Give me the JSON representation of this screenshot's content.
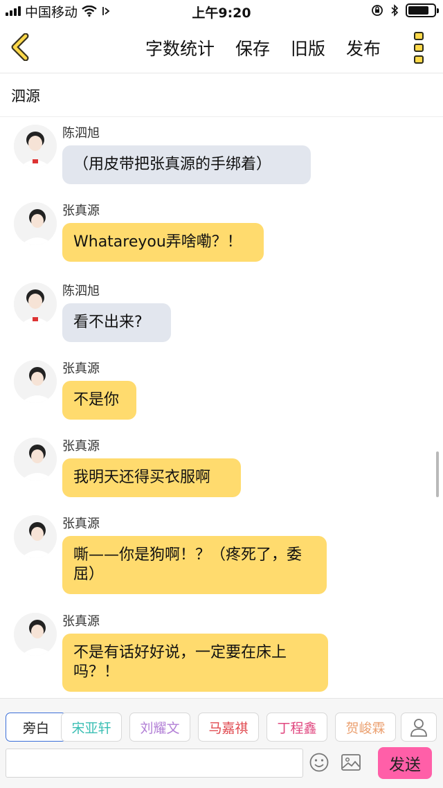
{
  "status_bar": {
    "carrier": "中国移动",
    "time": "上午9:20"
  },
  "toolbar": {
    "word_count_label": "字数统计",
    "save_label": "保存",
    "old_version_label": "旧版",
    "publish_label": "发布"
  },
  "title": "泗源",
  "messages": [
    {
      "sender": "陈泗旭",
      "text": "（用皮带把张真源的手绑着）",
      "style": "gray"
    },
    {
      "sender": "张真源",
      "text": "Whatareyou弄啥嘞？！",
      "style": "yellow"
    },
    {
      "sender": "陈泗旭",
      "text": "看不出来?",
      "style": "gray"
    },
    {
      "sender": "张真源",
      "text": "不是你",
      "style": "yellow"
    },
    {
      "sender": "张真源",
      "text": "我明天还得买衣服啊",
      "style": "yellow"
    },
    {
      "sender": "张真源",
      "text": "嘶——你是狗啊！？（疼死了，委屈）",
      "style": "yellow"
    },
    {
      "sender": "张真源",
      "text": "不是有话好好说，一定要在床上吗？！",
      "style": "yellow"
    }
  ],
  "roles": [
    {
      "label": "旁白",
      "color": "#222222"
    },
    {
      "label": "宋亚轩",
      "color": "#3bbfb4"
    },
    {
      "label": "刘耀文",
      "color": "#b27fd6"
    },
    {
      "label": "马嘉祺",
      "color": "#e0494f"
    },
    {
      "label": "丁程鑫",
      "color": "#e0477f"
    },
    {
      "label": "贺峻霖",
      "color": "#eba070"
    }
  ],
  "input": {
    "value": "",
    "placeholder": ""
  },
  "send_label": "发送",
  "icons": {
    "back": "chevron-left-icon",
    "more": "more-vertical-icon",
    "user": "user-icon",
    "emoji": "smiley-icon",
    "image": "image-icon"
  },
  "colors": {
    "accent_yellow": "#ffdb6e",
    "bubble_gray": "#e2e6ee",
    "send_pink": "#ff5fa8"
  }
}
